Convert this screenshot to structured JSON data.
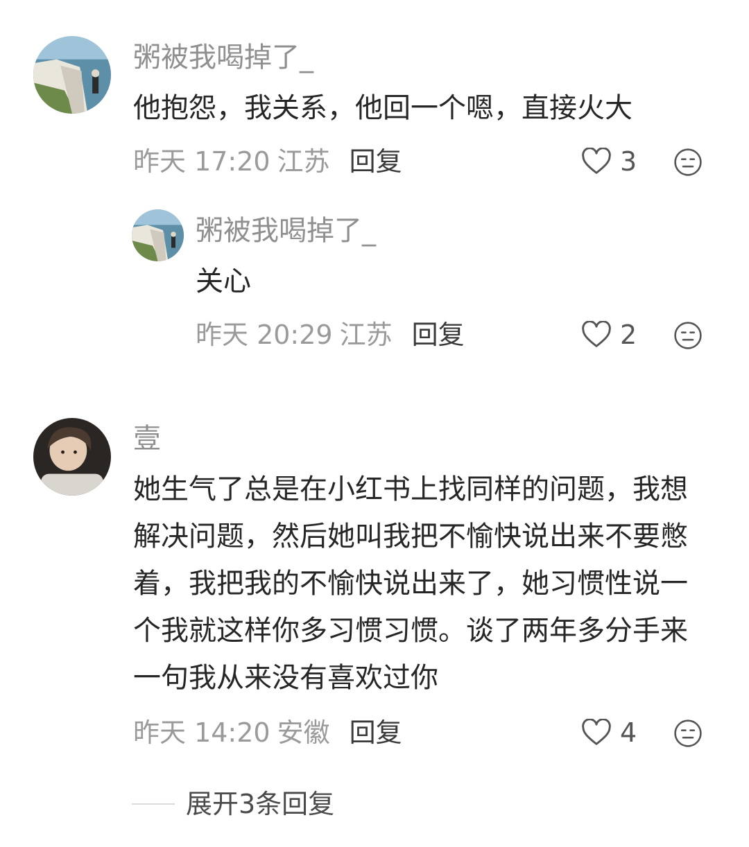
{
  "comments": [
    {
      "username": "粥被我喝掉了_",
      "text": "他抱怨，我关系，他回一个嗯，直接火大",
      "time": "昨天 17:20",
      "location": "江苏",
      "reply_label": "回复",
      "likes": "3",
      "avatar": "cliff-avatar"
    },
    {
      "username": "粥被我喝掉了_",
      "text": "关心",
      "time": "昨天 20:29",
      "location": "江苏",
      "reply_label": "回复",
      "likes": "2",
      "avatar": "cliff-avatar"
    },
    {
      "username": "壹",
      "text": "她生气了总是在小红书上找同样的问题，我想解决问题，然后她叫我把不愉快说出来不要憋着，我把我的不愉快说出来了，她习惯性说一个我就这样你多习惯习惯。谈了两年多分手来一句我从来没有喜欢过你",
      "time": "昨天 14:20",
      "location": "安徽",
      "reply_label": "回复",
      "likes": "4",
      "avatar": "person-avatar"
    }
  ],
  "expand_replies": "展开3条回复",
  "colors": {
    "username": "#8f8f8f",
    "body": "#262626",
    "meta": "#9a9a9a",
    "icon": "#555555"
  }
}
